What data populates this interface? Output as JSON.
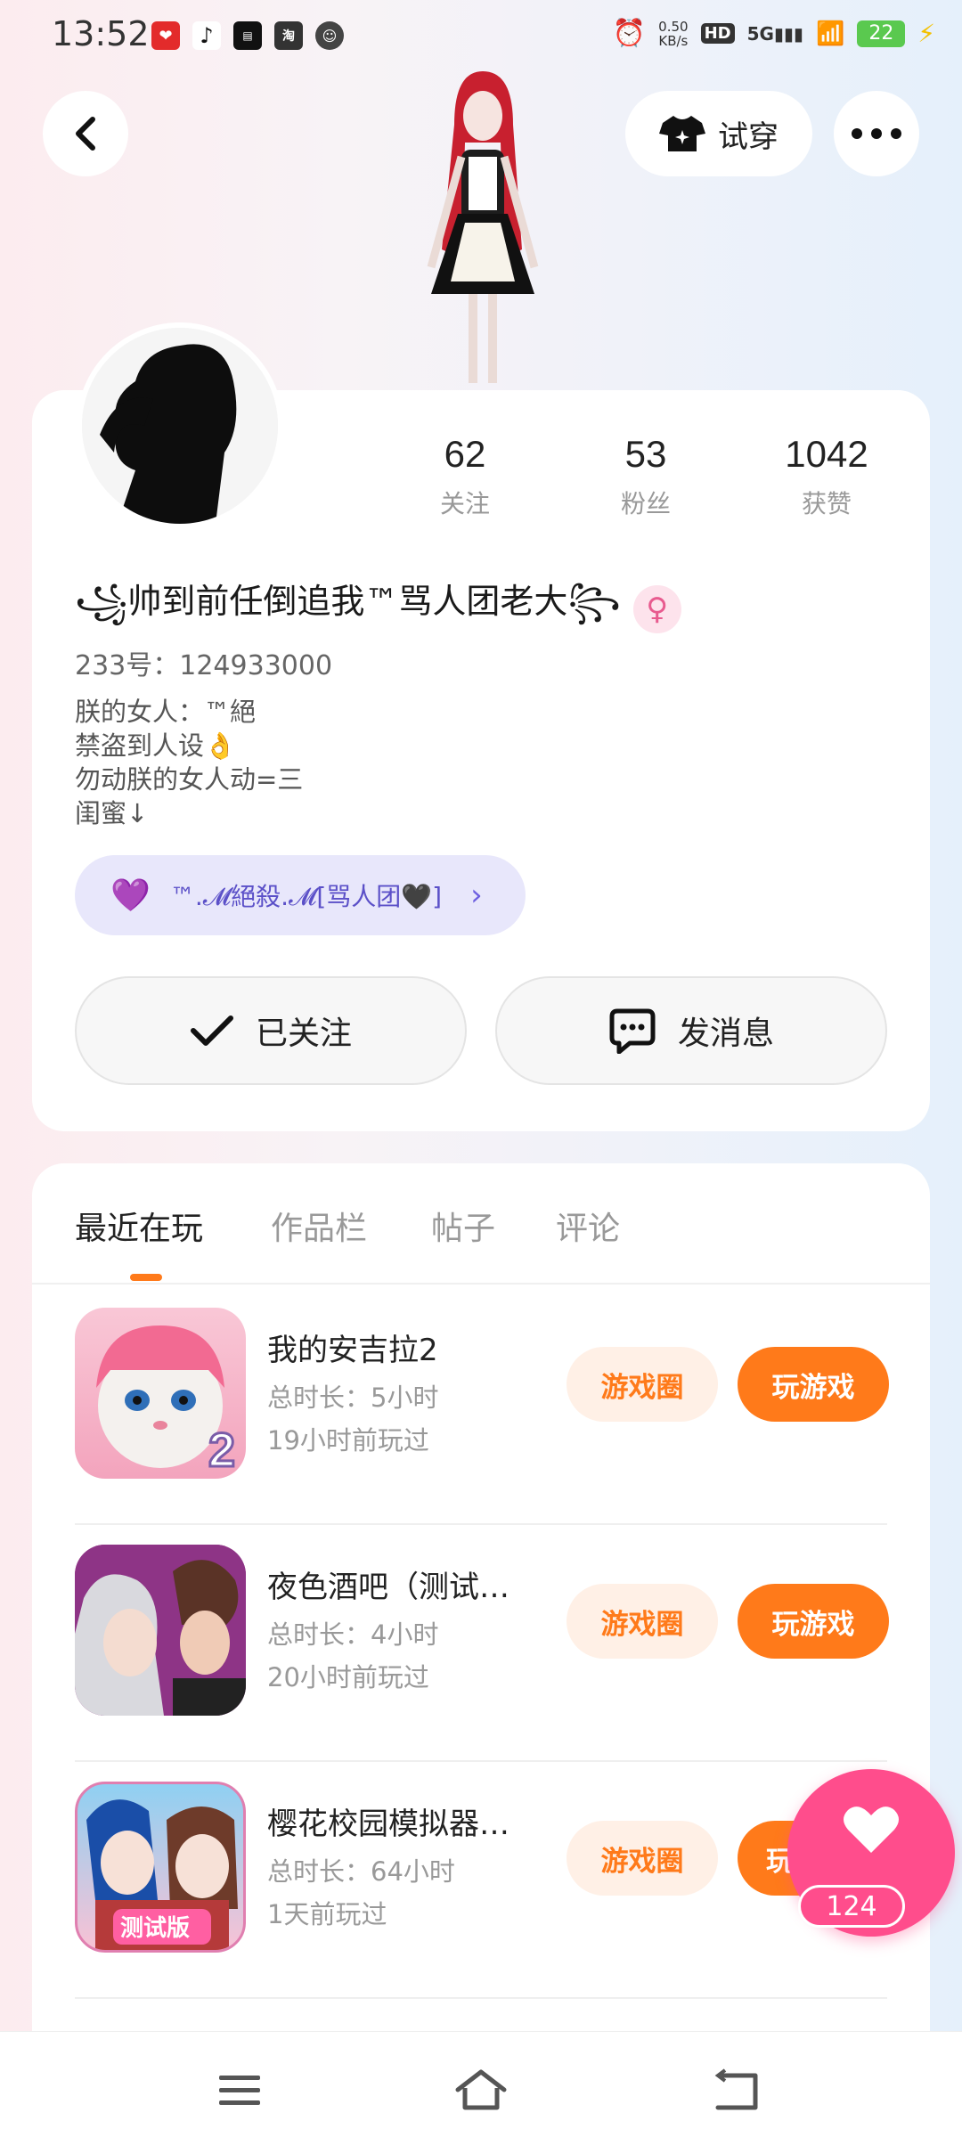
{
  "status": {
    "time": "13:52",
    "net_speed": "0.50",
    "net_unit": "KB/s",
    "hd": "HD",
    "signal": "5G",
    "battery": "22"
  },
  "header": {
    "try_on_label": "试穿"
  },
  "profile": {
    "stats": [
      {
        "value": "62",
        "label": "关注"
      },
      {
        "value": "53",
        "label": "粉丝"
      },
      {
        "value": "1042",
        "label": "获赞"
      }
    ],
    "name": "꧁帅到前任倒追我™骂人团老大꧂",
    "id_text": "233号：124933000",
    "bio": [
      "朕的女人：™絕",
      "禁盗到人设👌",
      "勿动朕的女人动=三",
      "闺蜜↓"
    ],
    "group_label": "™.𝓜絕殺.𝓜[骂人团🖤]",
    "follow_label": "已关注",
    "message_label": "发消息"
  },
  "tabs": [
    "最近在玩",
    "作品栏",
    "帖子",
    "评论"
  ],
  "games": [
    {
      "name": "我的安吉拉2",
      "duration": "总时长：5小时",
      "last_played": "19小时前玩过",
      "circle_label": "游戏圈",
      "play_label": "玩游戏"
    },
    {
      "name": "夜色酒吧（测试…",
      "duration": "总时长：4小时",
      "last_played": "20小时前玩过",
      "circle_label": "游戏圈",
      "play_label": "玩游戏"
    },
    {
      "name": "樱花校园模拟器…",
      "duration": "总时长：64小时",
      "last_played": "1天前玩过",
      "circle_label": "游戏圈",
      "play_label": "玩"
    }
  ],
  "game_icon_text": {
    "angela_badge": "2",
    "sakura_badge": "测试版"
  },
  "like_count": "124",
  "colors": {
    "accent": "#ff7a1a",
    "like": "#ff4d8c",
    "group_bg": "#e8e7fb"
  }
}
